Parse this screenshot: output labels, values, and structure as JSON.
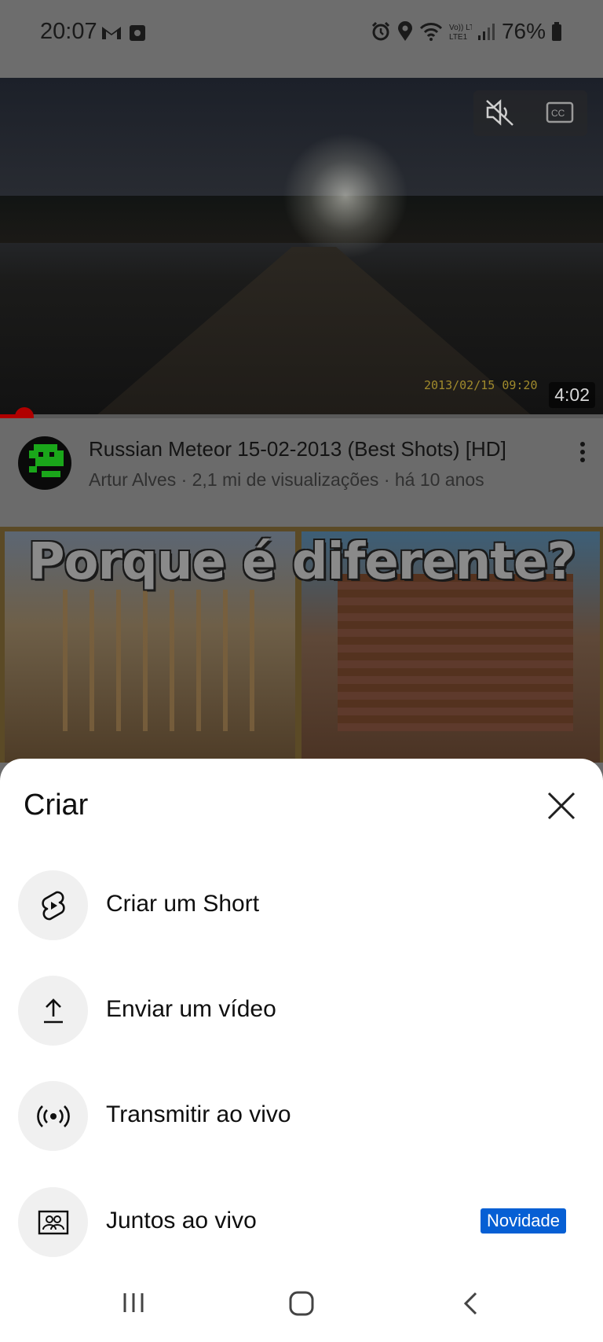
{
  "status_bar": {
    "time": "20:07",
    "left_icons": [
      "gmail-icon",
      "notification-icon"
    ],
    "right_icons": [
      "alarm-icon",
      "location-icon",
      "wifi-icon",
      "volte-icon",
      "signal-icon"
    ],
    "volte_label": "Vo)) LTE1",
    "battery_percent": "76%"
  },
  "player": {
    "duration": "4:02",
    "dashcam_overlay": "2013/02/15 09:20",
    "muted": true,
    "progress_fraction": 0.04,
    "accent_color": "#b00000"
  },
  "video": {
    "title": "Russian Meteor 15-02-2013 (Best Shots) [HD]",
    "subtitle": "Artur Alves · 2,1 mi de visualizações · há 10 anos"
  },
  "next_thumbnail": {
    "caption": "Porque é diferente?"
  },
  "create_sheet": {
    "title": "Criar",
    "items": [
      {
        "label": "Criar um Short",
        "icon": "shorts-icon"
      },
      {
        "label": "Enviar um vídeo",
        "icon": "upload-icon"
      },
      {
        "label": "Transmitir ao vivo",
        "icon": "live-icon"
      },
      {
        "label": "Juntos ao vivo",
        "icon": "together-live-icon",
        "badge": "Novidade"
      }
    ],
    "badge_color": "#065fd4"
  },
  "nav_bar": {
    "buttons": [
      "recents-button",
      "home-button",
      "back-button"
    ]
  }
}
